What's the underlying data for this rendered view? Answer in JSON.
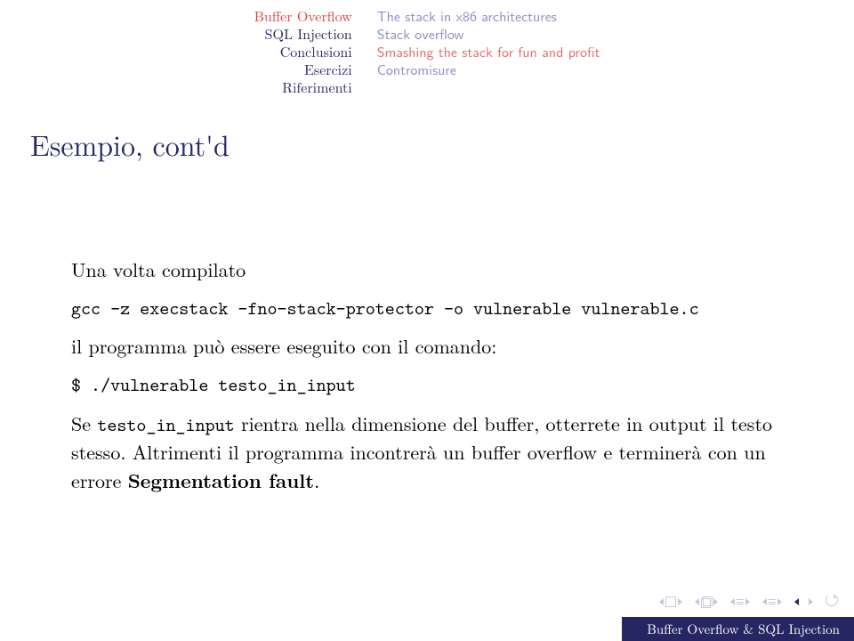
{
  "header": {
    "sections": [
      "Buffer Overflow",
      "SQL Injection",
      "Conclusioni",
      "Esercizi",
      "Riferimenti"
    ],
    "active_section": "Buffer Overflow",
    "subsections": [
      "The stack in x86 architectures",
      "Stack overflow",
      "Smashing the stack for fun and profit",
      "Contromisure"
    ],
    "active_subsection": "Smashing the stack for fun and profit"
  },
  "title": "Esempio, cont'd",
  "content": {
    "p1": "Una volta compilato",
    "cmd1": "gcc -z execstack -fno-stack-protector -o vulnerable vulnerable.c",
    "p2": "il programma può essere eseguito con il comando:",
    "cmd2": "$ ./vulnerable testo_in_input",
    "p3_a": "Se ",
    "p3_code": "testo_in_input",
    "p3_b": " rientra nella dimensione del buffer, otterrete in output il testo stesso. Altrimenti il programma incontrerà un buffer overflow e terminerà con un errore ",
    "p3_bold": "Segmentation fault",
    "p3_c": "."
  },
  "footer": {
    "title": "Buffer Overflow & SQL Injection"
  }
}
